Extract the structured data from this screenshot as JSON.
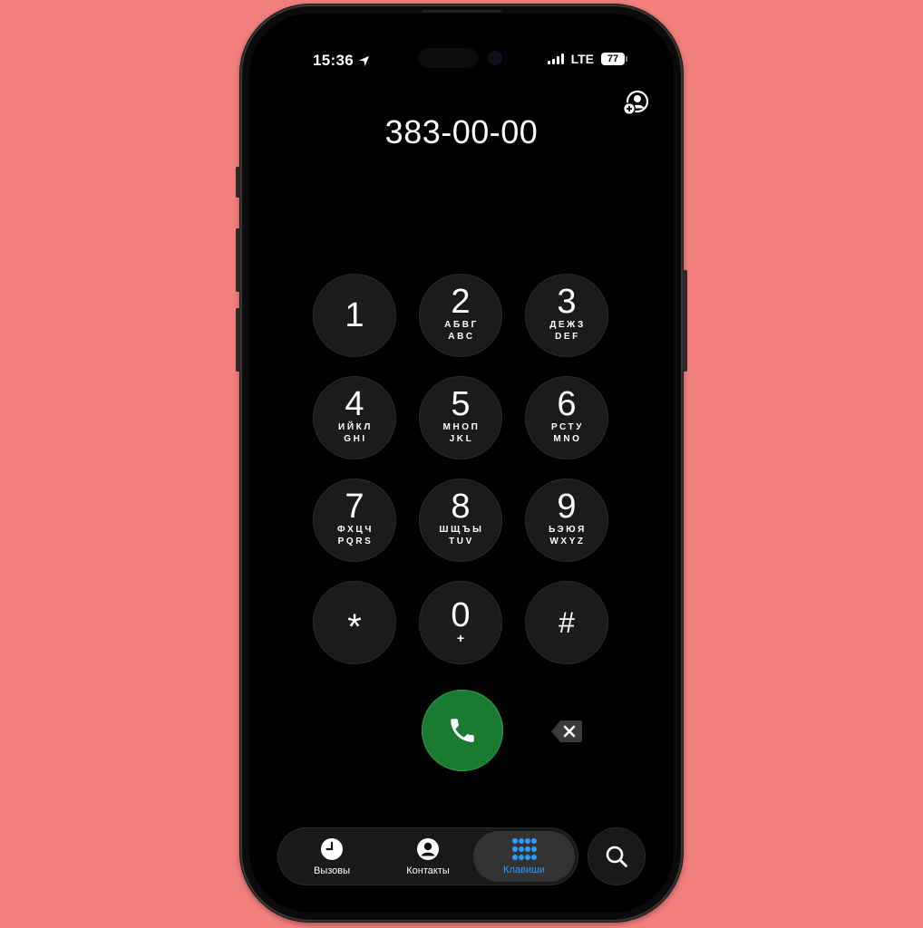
{
  "status": {
    "time": "15:36",
    "network": "LTE",
    "battery": "77"
  },
  "dialer": {
    "number": "383-00-00"
  },
  "keypad": {
    "k1": {
      "digit": "1"
    },
    "k2": {
      "digit": "2",
      "cyr": "АБВГ",
      "lat": "ABC"
    },
    "k3": {
      "digit": "3",
      "cyr": "ДЕЖЗ",
      "lat": "DEF"
    },
    "k4": {
      "digit": "4",
      "cyr": "ИЙКЛ",
      "lat": "GHI"
    },
    "k5": {
      "digit": "5",
      "cyr": "МНОП",
      "lat": "JKL"
    },
    "k6": {
      "digit": "6",
      "cyr": "РСТУ",
      "lat": "MNO"
    },
    "k7": {
      "digit": "7",
      "cyr": "ФХЦЧ",
      "lat": "PQRS"
    },
    "k8": {
      "digit": "8",
      "cyr": "ШЩЪЫ",
      "lat": "TUV"
    },
    "k9": {
      "digit": "9",
      "cyr": "ЬЭЮЯ",
      "lat": "WXYZ"
    },
    "kstar": {
      "digit": "*"
    },
    "k0": {
      "digit": "0",
      "plus": "+"
    },
    "khash": {
      "digit": "#"
    }
  },
  "tabs": {
    "recents": "Вызовы",
    "contacts": "Контакты",
    "keypad": "Клавиши"
  },
  "colors": {
    "background": "#f07f7e",
    "call_green": "#1b7a31",
    "accent_blue": "#2e9bff"
  },
  "icons": {
    "location": "location-arrow-icon",
    "add_contact": "add-contact-icon",
    "call": "phone-icon",
    "delete": "backspace-icon",
    "recents": "clock-icon",
    "contacts": "person-circle-icon",
    "keypad": "keypad-grid-icon",
    "search": "search-icon"
  }
}
